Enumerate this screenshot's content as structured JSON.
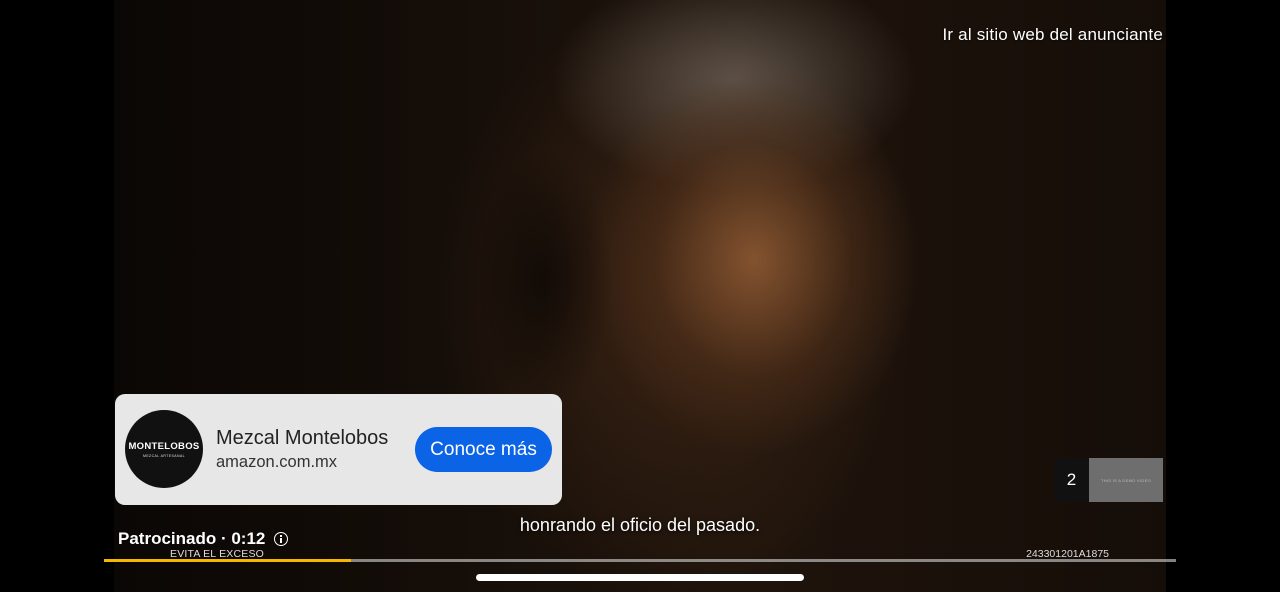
{
  "header": {
    "visit_advertiser": "Ir al sitio web del anunciante"
  },
  "ad": {
    "logo_text": "MONTELOBOS",
    "logo_subtext": "MEZCAL ARTESANAL",
    "title": "Mezcal Montelobos",
    "domain": "amazon.com.mx",
    "cta_label": "Conoce más"
  },
  "subtitle": "honrando el oficio del pasado.",
  "status": {
    "sponsored_label": "Patrocinado · 0:12"
  },
  "legal": {
    "warning": "EVITA EL EXCESO",
    "code": "243301201A1875"
  },
  "progress": {
    "played_fraction": 0.23
  },
  "skip": {
    "count": "2",
    "thumb_text": "THIS IS A DEMO VIDEO"
  },
  "colors": {
    "progress_accent": "#f5b800",
    "cta_blue": "#0b63e5"
  }
}
